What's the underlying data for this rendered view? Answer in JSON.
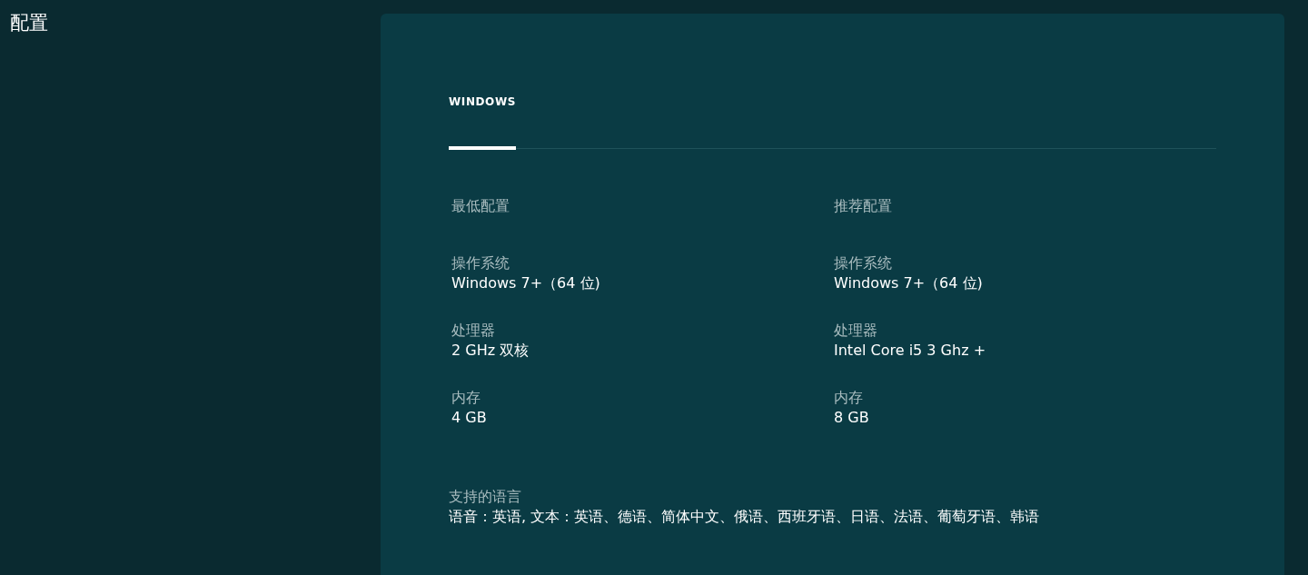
{
  "page_title": "配置",
  "tabs": [
    {
      "label": "WINDOWS",
      "selected": true
    }
  ],
  "columns": [
    {
      "heading": "最低配置",
      "specs": [
        {
          "label": "操作系统",
          "value": "Windows 7+（64 位)"
        },
        {
          "label": "处理器",
          "value": "2 GHz 双核"
        },
        {
          "label": "内存",
          "value": "4 GB"
        }
      ]
    },
    {
      "heading": "推荐配置",
      "specs": [
        {
          "label": "操作系统",
          "value": "Windows 7+（64 位)"
        },
        {
          "label": "处理器",
          "value": "Intel Core i5 3 Ghz +"
        },
        {
          "label": "内存",
          "value": "8 GB"
        }
      ]
    }
  ],
  "languages": {
    "label": "支持的语言",
    "value": "语音：英语, 文本：英语、德语、简体中文、俄语、西班牙语、日语、法语、葡萄牙语、韩语"
  }
}
